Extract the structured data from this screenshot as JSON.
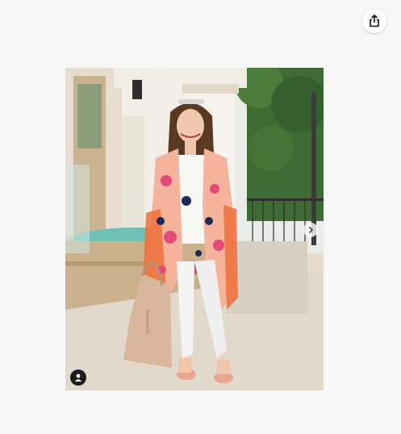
{
  "viewer": {
    "share_icon": "share-icon",
    "next_icon": "chevron-right-icon",
    "profile_icon": "user-icon"
  },
  "photo": {
    "colors": {
      "sky": "#e9ece8",
      "wall": "#f1ede6",
      "trees": "#3f6b34",
      "fountain_water": "#6fc1b5",
      "kimono": "#f4b39a",
      "jeans": "#f4f4f4",
      "bag": "#d9b79c"
    }
  }
}
